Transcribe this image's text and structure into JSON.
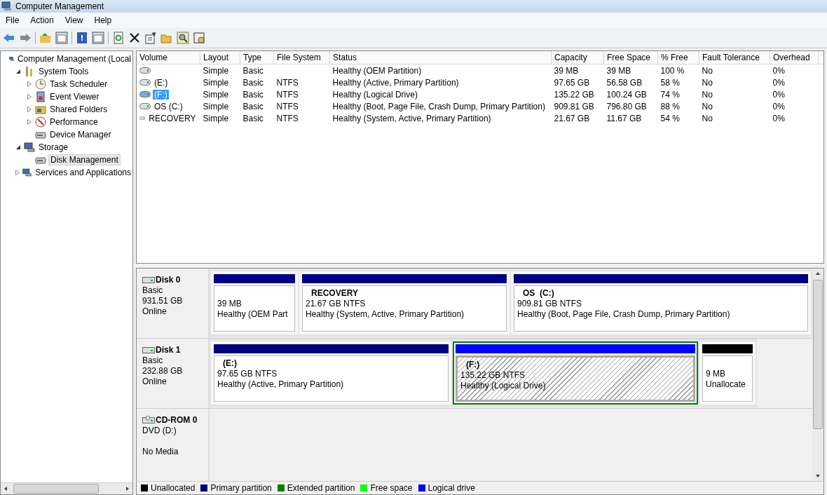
{
  "window": {
    "title": "Computer Management"
  },
  "menu": [
    "File",
    "Action",
    "View",
    "Help"
  ],
  "tree": [
    {
      "label": "Computer Management (Local",
      "selected": false,
      "children": [
        {
          "label": "System Tools",
          "expanded": true,
          "selected": false,
          "children": [
            {
              "label": "Task Scheduler",
              "expanded": false,
              "selected": false
            },
            {
              "label": "Event Viewer",
              "expanded": false,
              "selected": false
            },
            {
              "label": "Shared Folders",
              "expanded": false,
              "selected": false
            },
            {
              "label": "Performance",
              "expanded": false,
              "selected": false
            },
            {
              "label": "Device Manager",
              "selected": false
            }
          ]
        },
        {
          "label": "Storage",
          "expanded": true,
          "selected": false,
          "children": [
            {
              "label": "Disk Management",
              "selected": true
            }
          ]
        },
        {
          "label": "Services and Applications",
          "expanded": false,
          "selected": false
        }
      ]
    }
  ],
  "table": {
    "columns": [
      "Volume",
      "Layout",
      "Type",
      "File System",
      "Status",
      "Capacity",
      "Free Space",
      "% Free",
      "Fault Tolerance",
      "Overhead"
    ],
    "rows": [
      {
        "selected": false,
        "cells": [
          "",
          "Simple",
          "Basic",
          "",
          "Healthy (OEM Partition)",
          "39 MB",
          "39 MB",
          "100 %",
          "No",
          "0%"
        ]
      },
      {
        "selected": false,
        "cells": [
          "(E:)",
          "Simple",
          "Basic",
          "NTFS",
          "Healthy (Active, Primary Partition)",
          "97.65 GB",
          "56.58 GB",
          "58 %",
          "No",
          "0%"
        ]
      },
      {
        "selected": true,
        "cells": [
          "(F:)",
          "Simple",
          "Basic",
          "NTFS",
          "Healthy (Logical Drive)",
          "135.22 GB",
          "100.24 GB",
          "74 %",
          "No",
          "0%"
        ]
      },
      {
        "selected": false,
        "cells": [
          "OS (C:)",
          "Simple",
          "Basic",
          "NTFS",
          "Healthy (Boot, Page File, Crash Dump, Primary Partition)",
          "909.81 GB",
          "796.80 GB",
          "88 %",
          "No",
          "0%"
        ]
      },
      {
        "selected": false,
        "cells": [
          "RECOVERY",
          "Simple",
          "Basic",
          "NTFS",
          "Healthy (System, Active, Primary Partition)",
          "21.67 GB",
          "11.67 GB",
          "54 %",
          "No",
          "0%"
        ]
      }
    ]
  },
  "disks": [
    {
      "kind": "disk",
      "name": "Disk 0",
      "lines": [
        "Basic",
        "931.51 GB",
        "Online"
      ],
      "partitions": [
        {
          "kind": "primary",
          "selected": false,
          "size": "39 MB",
          "status": "Healthy (OEM Part"
        },
        {
          "kind": "primary",
          "selected": false,
          "label": "RECOVERY",
          "size": "21.67 GB NTFS",
          "status": "Healthy (System, Active, Primary Partition)"
        },
        {
          "kind": "primary",
          "selected": false,
          "label": "OS  (C:)",
          "size": "909.81 GB NTFS",
          "status": "Healthy (Boot, Page File, Crash Dump, Primary Partition)"
        }
      ]
    },
    {
      "kind": "disk",
      "name": "Disk 1",
      "lines": [
        "Basic",
        "232.88 GB",
        "Online"
      ],
      "partitions": [
        {
          "kind": "primary",
          "selected": false,
          "label": "(E:)",
          "size": "97.65 GB NTFS",
          "status": "Healthy (Active, Primary Partition)"
        },
        {
          "kind": "logical",
          "selected": true,
          "label": "(F:)",
          "size": "135.22 GB NTFS",
          "status": "Healthy (Logical Drive)"
        },
        {
          "kind": "unallocated",
          "selected": false,
          "size": "9 MB",
          "status": "Unallocate"
        }
      ]
    },
    {
      "kind": "cdrom",
      "name": "CD-ROM 0",
      "lines": [
        "DVD (D:)"
      ],
      "note": "No Media"
    }
  ],
  "legend": [
    {
      "label": "Unallocated",
      "color": "#000000"
    },
    {
      "label": "Primary partition",
      "color": "#000080"
    },
    {
      "label": "Extended partition",
      "color": "#008000"
    },
    {
      "label": "Free space",
      "color": "#00ff00"
    },
    {
      "label": "Logical drive",
      "color": "#0000ff"
    }
  ]
}
